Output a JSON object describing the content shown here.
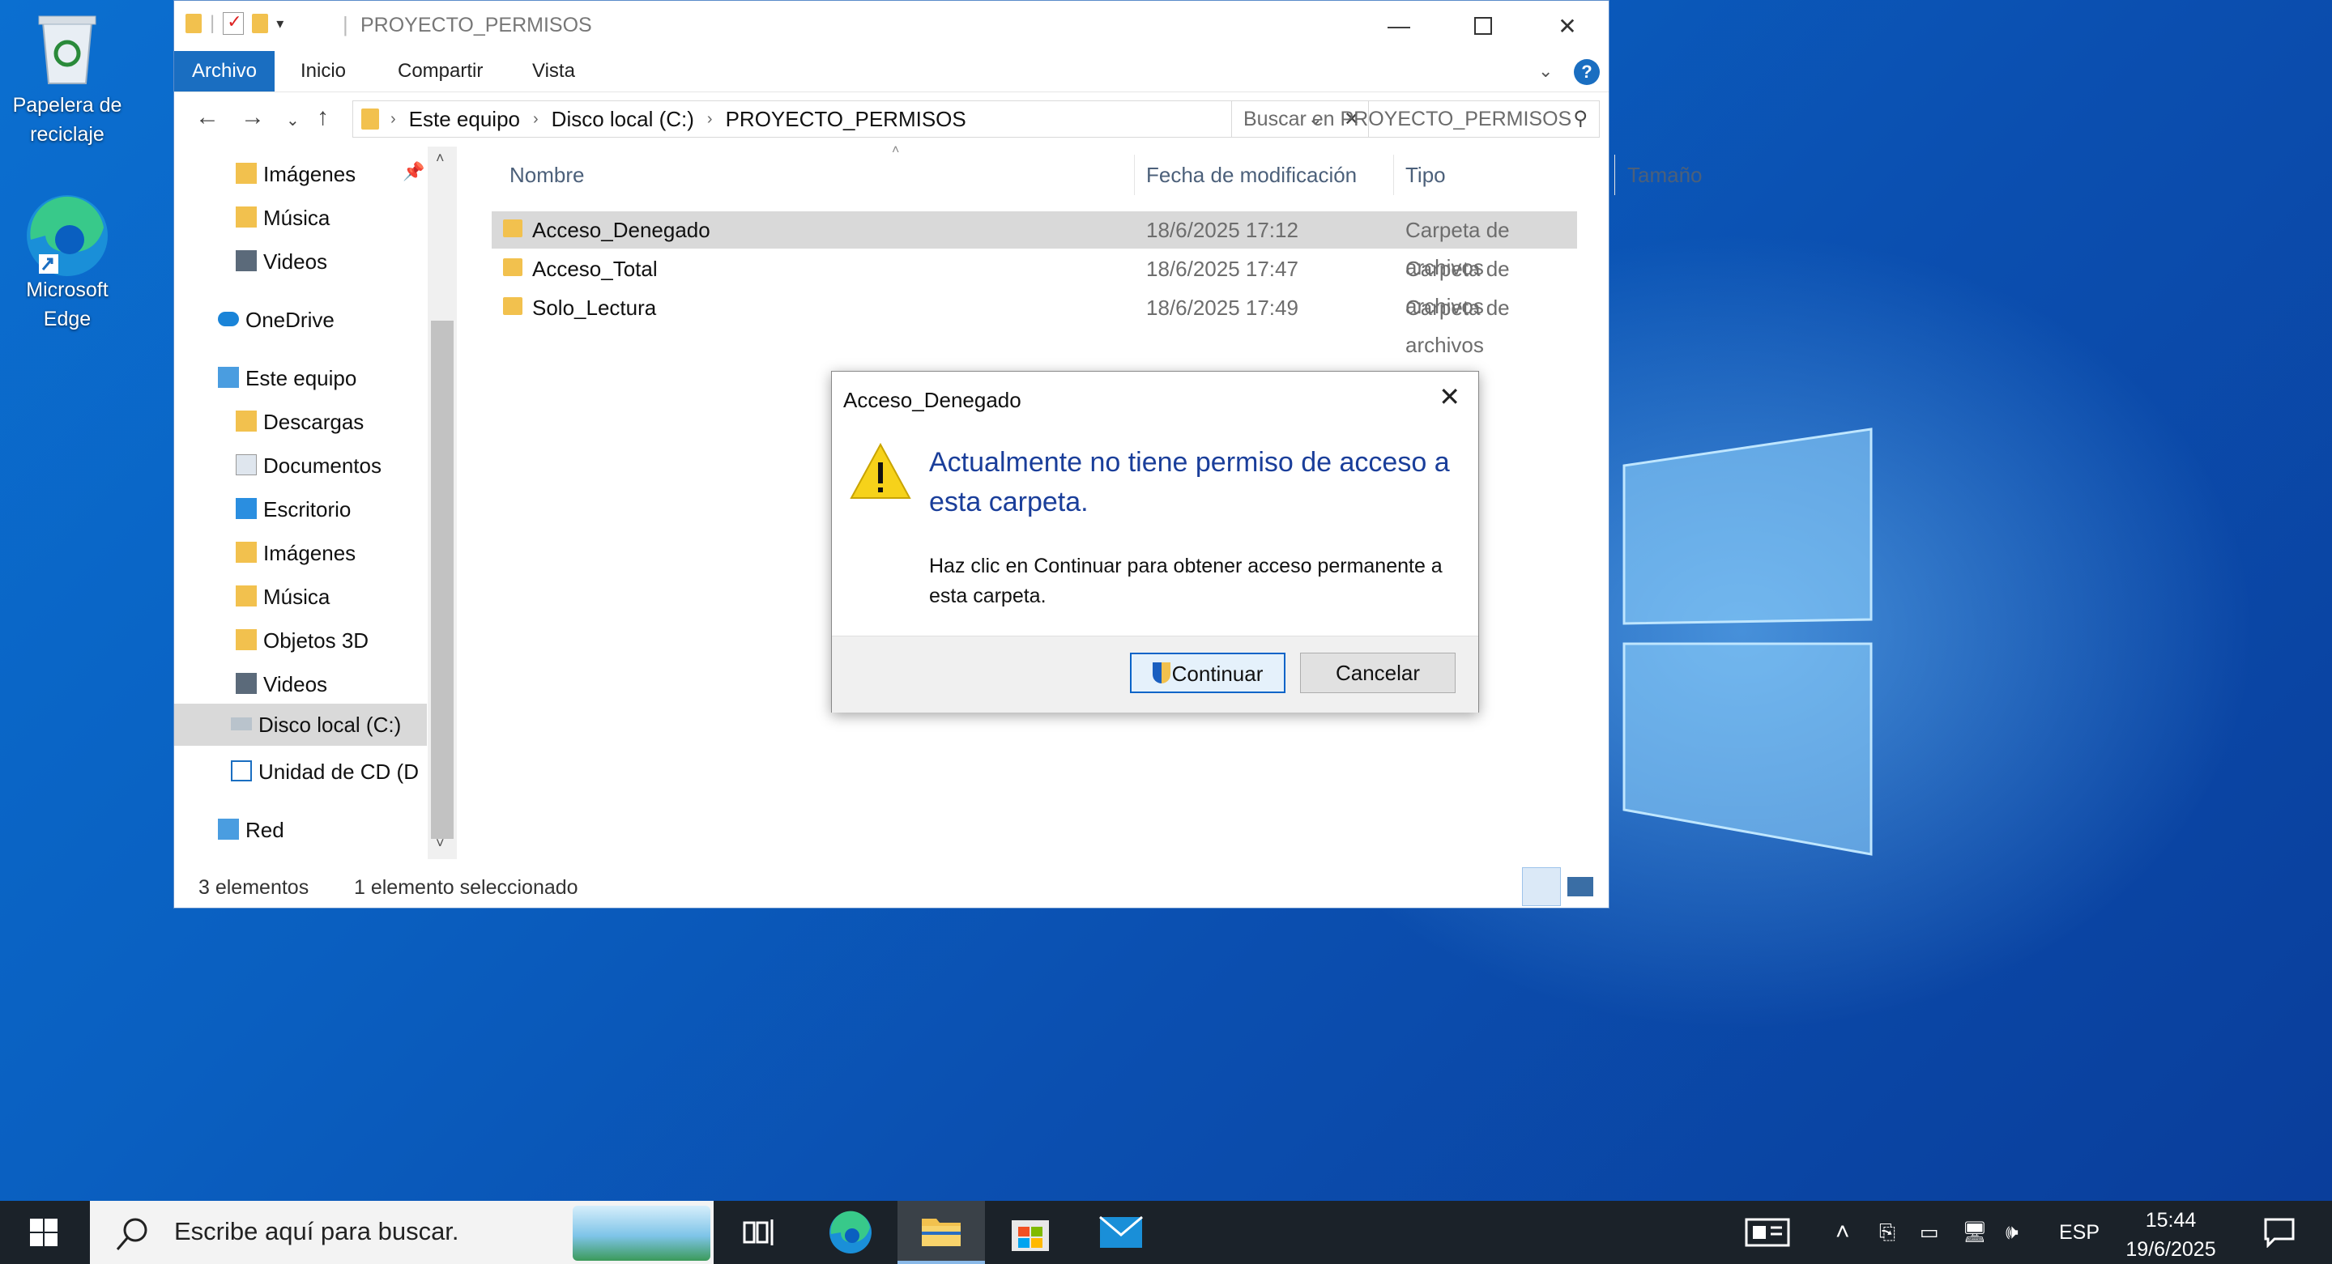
{
  "desktop": {
    "icons": [
      {
        "label_line1": "Papelera de",
        "label_line2": "reciclaje"
      },
      {
        "label_line1": "Microsoft",
        "label_line2": "Edge"
      }
    ]
  },
  "explorer": {
    "title": "PROYECTO_PERMISOS",
    "ribbon_tabs": [
      "Archivo",
      "Inicio",
      "Compartir",
      "Vista"
    ],
    "address": [
      "Este equipo",
      "Disco local (C:)",
      "PROYECTO_PERMISOS"
    ],
    "search_placeholder": "Buscar en PROYECTO_PERMISOS",
    "nav": [
      {
        "label": "Imágenes",
        "icon": "pictures-icon"
      },
      {
        "label": "Música",
        "icon": "music-icon"
      },
      {
        "label": "Videos",
        "icon": "videos-icon"
      },
      {
        "label": "OneDrive",
        "icon": "onedrive-icon"
      },
      {
        "label": "Este equipo",
        "icon": "computer-icon"
      },
      {
        "label": "Descargas",
        "icon": "downloads-icon"
      },
      {
        "label": "Documentos",
        "icon": "documents-icon"
      },
      {
        "label": "Escritorio",
        "icon": "desktop-folder-icon"
      },
      {
        "label": "Imágenes",
        "icon": "pictures-icon"
      },
      {
        "label": "Música",
        "icon": "music-icon"
      },
      {
        "label": "Objetos 3D",
        "icon": "objects3d-icon"
      },
      {
        "label": "Videos",
        "icon": "videos-icon"
      },
      {
        "label": "Disco local (C:)",
        "icon": "drive-icon"
      },
      {
        "label": "Unidad de CD (D",
        "icon": "cd-drive-icon"
      },
      {
        "label": "Red",
        "icon": "network-icon"
      }
    ],
    "columns": [
      "Nombre",
      "Fecha de modificación",
      "Tipo",
      "Tamaño"
    ],
    "files": [
      {
        "name": "Acceso_Denegado",
        "date": "18/6/2025 17:12",
        "type": "Carpeta de archivos"
      },
      {
        "name": "Acceso_Total",
        "date": "18/6/2025 17:47",
        "type": "Carpeta de archivos"
      },
      {
        "name": "Solo_Lectura",
        "date": "18/6/2025 17:49",
        "type": "Carpeta de archivos"
      }
    ],
    "status_count": "3 elementos",
    "status_selected": "1 elemento seleccionado"
  },
  "dialog": {
    "title": "Acceso_Denegado",
    "heading": "Actualmente no tiene permiso de acceso a esta carpeta.",
    "body": "Haz clic en Continuar para obtener acceso permanente a esta carpeta.",
    "continue_label": "Continuar",
    "cancel_label": "Cancelar"
  },
  "taskbar": {
    "search_placeholder": "Escribe aquí para buscar.",
    "language": "ESP",
    "time": "15:44",
    "date": "19/6/2025"
  },
  "colors": {
    "accent": "#1a6ec1",
    "heading": "#1a3e9a",
    "folder": "#f2c14e",
    "taskbar": "#1b2229"
  }
}
